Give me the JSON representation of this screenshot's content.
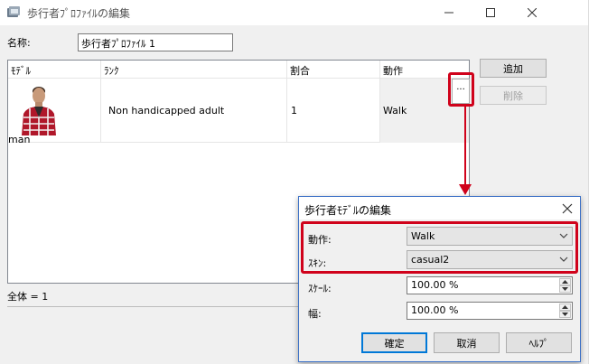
{
  "main_window": {
    "title": "歩行者ﾌﾟﾛﾌｧｲﾙの編集",
    "name_label": "名称:",
    "name_value": "歩行者ﾌﾟﾛﾌｧｲﾙ 1",
    "columns": [
      "ﾓﾃﾞﾙ",
      "ﾗﾝｸ",
      "割合",
      "動作"
    ],
    "row": {
      "model": "man",
      "rank": "Non handicapped adult",
      "ratio": "1",
      "motion": "Walk"
    },
    "dots_button": "...",
    "add_button": "追加",
    "delete_button": "削除",
    "total_label": "全体 = 1"
  },
  "dialog": {
    "title": "歩行者ﾓﾃﾞﾙの編集",
    "motion_label": "動作:",
    "motion_value": "Walk",
    "skin_label": "ｽｷﾝ:",
    "skin_value": "casual2",
    "scale_label": "ｽｹｰﾙ:",
    "scale_value": "100.00 %",
    "width_label": "幅:",
    "width_value": "100.00 %",
    "ok_button": "確定",
    "cancel_button": "取消",
    "help_button": "ﾍﾙﾌﾟ"
  },
  "colors": {
    "highlight": "#d0021b",
    "focus": "#0078d7"
  },
  "icons": [
    "app-icon",
    "minimize-icon",
    "maximize-icon",
    "close-icon",
    "chevron-down-icon",
    "spin-up-icon",
    "spin-down-icon",
    "arrow-down-icon"
  ]
}
